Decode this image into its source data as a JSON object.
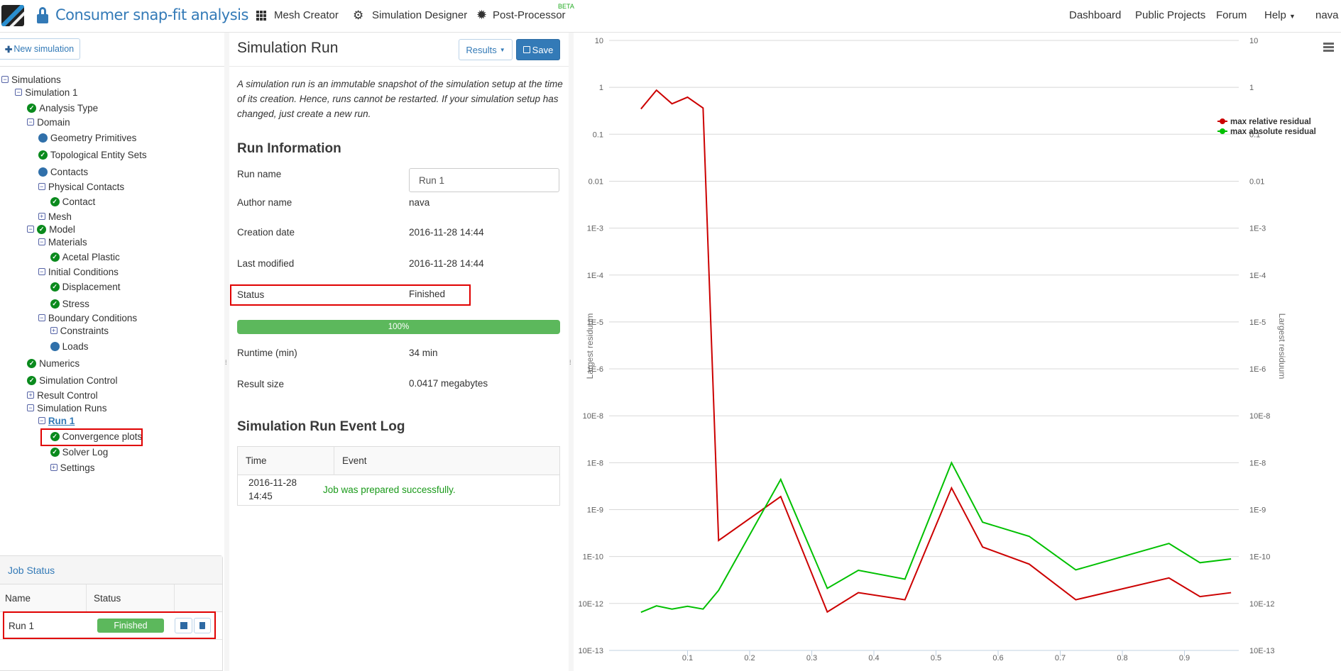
{
  "nav": {
    "title": "Consumer snap-fit analysis",
    "center": [
      {
        "label": "Mesh Creator",
        "icon": "grid-icon"
      },
      {
        "label": "Simulation Designer",
        "icon": "gears-icon"
      },
      {
        "label": "Post-Processor",
        "icon": "cog-icon",
        "badge": "BETA"
      }
    ],
    "right": [
      "Dashboard",
      "Public Projects",
      "Forum",
      "Help",
      "nava"
    ]
  },
  "sidebar": {
    "new_simulation": "New simulation",
    "tree": [
      {
        "label": "Simulations",
        "state": "minus"
      },
      {
        "label": "Simulation 1",
        "state": "minus"
      },
      {
        "label": "Analysis Type",
        "state": "check"
      },
      {
        "label": "Domain",
        "state": "minus"
      },
      {
        "label": "Geometry Primitives",
        "state": "dot"
      },
      {
        "label": "Topological Entity Sets",
        "state": "check"
      },
      {
        "label": "Contacts",
        "state": "dot"
      },
      {
        "label": "Physical Contacts",
        "state": "minus"
      },
      {
        "label": "Contact",
        "state": "check"
      },
      {
        "label": "Mesh",
        "state": "plus"
      },
      {
        "label": "Model",
        "state": "minus-check"
      },
      {
        "label": "Materials",
        "state": "minus"
      },
      {
        "label": "Acetal Plastic",
        "state": "check"
      },
      {
        "label": "Initial Conditions",
        "state": "minus"
      },
      {
        "label": "Displacement",
        "state": "check"
      },
      {
        "label": "Stress",
        "state": "check"
      },
      {
        "label": "Boundary Conditions",
        "state": "minus"
      },
      {
        "label": "Constraints",
        "state": "plus"
      },
      {
        "label": "Loads",
        "state": "dot"
      },
      {
        "label": "Numerics",
        "state": "check"
      },
      {
        "label": "Simulation Control",
        "state": "check"
      },
      {
        "label": "Result Control",
        "state": "plus"
      },
      {
        "label": "Simulation Runs",
        "state": "minus"
      },
      {
        "label": "Run 1",
        "state": "minus"
      },
      {
        "label": "Convergence plots",
        "state": "check"
      },
      {
        "label": "Solver Log",
        "state": "check"
      },
      {
        "label": "Settings",
        "state": "plus"
      }
    ],
    "job_status": {
      "title": "Job Status",
      "columns": [
        "Name",
        "Status",
        ""
      ],
      "rows": [
        {
          "name": "Run 1",
          "status": "Finished"
        }
      ]
    }
  },
  "run": {
    "title": "Simulation Run",
    "results_label": "Results",
    "save_label": "Save",
    "description": "A simulation run is an immutable snapshot of the simulation setup at the time of its creation. Hence, runs cannot be restarted. If your simulation setup has changed, just create a new run.",
    "info_heading": "Run Information",
    "run_name_label": "Run name",
    "run_name_value": "Run 1",
    "author_label": "Author name",
    "author_value": "nava",
    "created_label": "Creation date",
    "created_value": "2016-11-28 14:44",
    "modified_label": "Last modified",
    "modified_value": "2016-11-28 14:44",
    "status_label": "Status",
    "status_value": "Finished",
    "progress": 100,
    "progress_label": "100%",
    "runtime_label": "Runtime (min)",
    "runtime_value": "34 min",
    "size_label": "Result size",
    "size_value": "0.0417 megabytes",
    "log_heading": "Simulation Run Event Log",
    "log_columns": [
      "Time",
      "Event"
    ],
    "log_rows": [
      {
        "time_date": "2016-11-28",
        "time_clock": "14:45",
        "event": "Job was prepared successfully."
      }
    ]
  },
  "chart_data": {
    "type": "line",
    "yscale": "log",
    "ylabel": "Largest residuum",
    "ylabel_right": "Largest residuum",
    "ylim": [
      1e-12,
      10
    ],
    "xlim": [
      0.02,
      0.98
    ],
    "xticks": [
      "0.1",
      "0.2",
      "0.3",
      "0.4",
      "0.5",
      "0.6",
      "0.7",
      "0.8",
      "0.9"
    ],
    "yticks": [
      "10",
      "1",
      "0.1",
      "0.01",
      "1E-3",
      "1E-4",
      "1E-5",
      "1E-6",
      "10E-8",
      "1E-8",
      "1E-9",
      "1E-10",
      "10E-12",
      "10E-13"
    ],
    "grid": true,
    "legend": "right",
    "x": [
      0.025,
      0.05,
      0.075,
      0.1,
      0.125,
      0.15,
      0.25,
      0.325,
      0.375,
      0.45,
      0.525,
      0.575,
      0.65,
      0.725,
      0.875,
      0.925,
      0.975
    ],
    "series": [
      {
        "name": "max relative residual",
        "color": "#cc0000",
        "values": [
          0.347,
          0.87,
          0.447,
          0.617,
          0.363,
          2.2e-10,
          1.9e-09,
          6.6e-12,
          1.7e-11,
          1.2e-11,
          2.9e-09,
          1.6e-10,
          6.9e-11,
          1.2e-11,
          3.5e-11,
          1.4e-11,
          1.7e-11
        ]
      },
      {
        "name": "max absolute residual",
        "color": "#00c000",
        "values": [
          6.5e-12,
          8.9e-12,
          7.6e-12,
          8.7e-12,
          7.6e-12,
          1.9e-11,
          4.4e-09,
          2.1e-11,
          5.1e-11,
          3.3e-11,
          1e-08,
          5.4e-10,
          2.7e-10,
          5.2e-11,
          1.9e-10,
          7.4e-11,
          8.9e-11
        ]
      }
    ]
  }
}
